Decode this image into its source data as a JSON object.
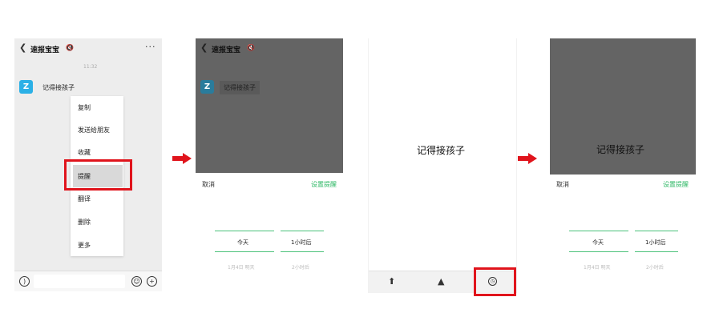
{
  "panel1": {
    "chat_title": "速报宝宝",
    "timestamp": "11:32",
    "avatar_letter": "Z",
    "message": "记得接孩子",
    "menu_items": [
      "复制",
      "发送给朋友",
      "收藏",
      "提醒",
      "翻译",
      "删除",
      "更多"
    ],
    "highlighted_item": "提醒"
  },
  "panel2": {
    "chat_title": "速报宝宝",
    "avatar_letter": "Z",
    "message": "记得接孩子",
    "cancel": "取消",
    "set_reminder": "设置提醒",
    "picker": {
      "day_selected": "今天",
      "day_next": "1月4日 明天",
      "hour_selected": "1小时后",
      "hour_next": "2小时后"
    }
  },
  "panel3": {
    "message": "记得接孩子",
    "toolbar_icons": [
      "share-icon",
      "cube-icon",
      "clock-icon"
    ],
    "highlighted_icon": "clock-icon"
  },
  "panel4": {
    "message": "记得接孩子",
    "cancel": "取消",
    "set_reminder": "设置提醒",
    "picker": {
      "day_selected": "今天",
      "day_next": "1月4日 明天",
      "hour_selected": "1小时后",
      "hour_next": "2小时后"
    }
  },
  "colors": {
    "accent_green": "#2fb866",
    "highlight_red": "#e0141c",
    "avatar_blue": "#2bb0e6",
    "overlay_gray": "#646464"
  }
}
